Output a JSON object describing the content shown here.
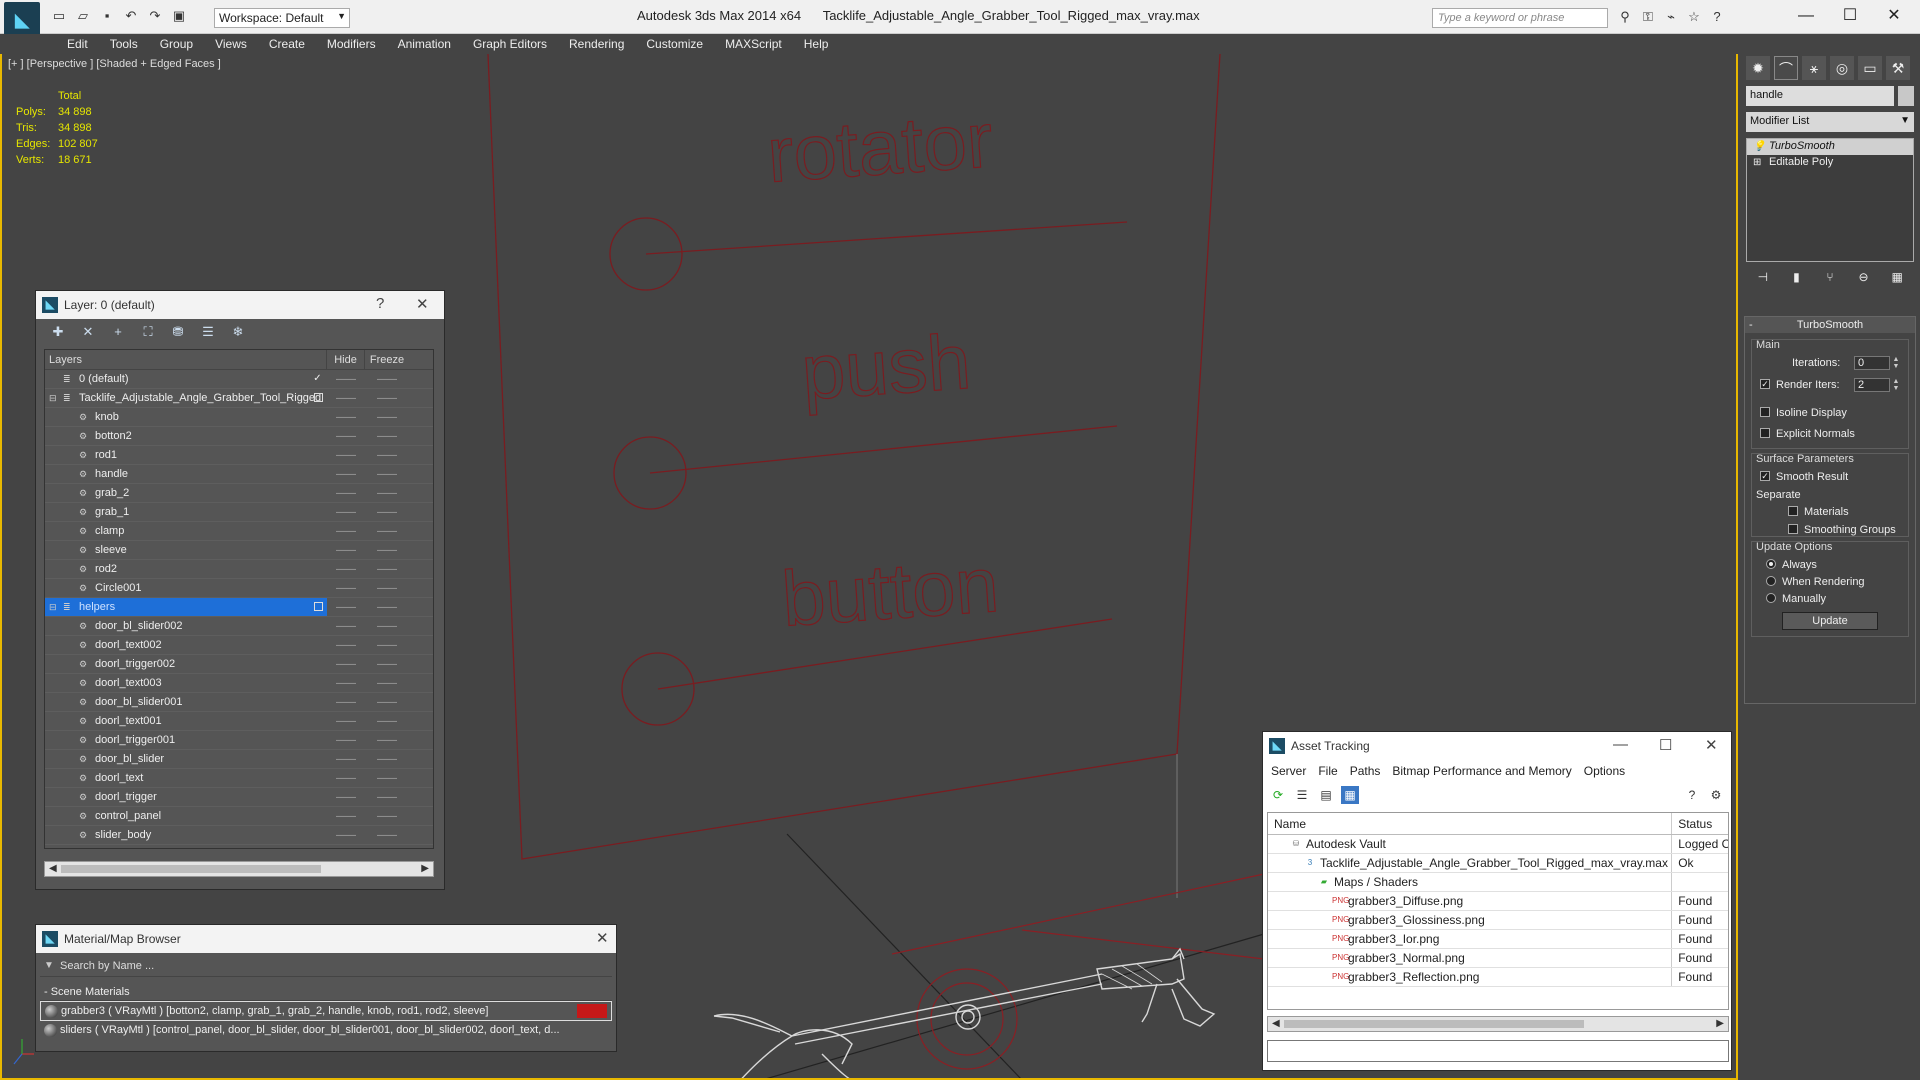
{
  "titlebar": {
    "workspace": "Workspace: Default",
    "app_title": "Autodesk 3ds Max  2014 x64",
    "file_title": "Tacklife_Adjustable_Angle_Grabber_Tool_Rigged_max_vray.max",
    "search_placeholder": "Type a keyword or phrase"
  },
  "menu": [
    "Edit",
    "Tools",
    "Group",
    "Views",
    "Create",
    "Modifiers",
    "Animation",
    "Graph Editors",
    "Rendering",
    "Customize",
    "MAXScript",
    "Help"
  ],
  "viewport": {
    "label": "[+ ] [Perspective ] [Shaded + Edged Faces ]",
    "stats": {
      "total_label": "Total",
      "polys_label": "Polys:",
      "polys": "34 898",
      "tris_label": "Tris:",
      "tris": "34 898",
      "edges_label": "Edges:",
      "edges": "102 807",
      "verts_label": "Verts:",
      "verts": "18 671"
    },
    "panel_labels": [
      "rotator",
      "push",
      "button"
    ]
  },
  "layer_dialog": {
    "title": "Layer: 0 (default)",
    "col_layers": "Layers",
    "col_hide": "Hide",
    "col_freeze": "Freeze",
    "rows": [
      {
        "name": "0 (default)",
        "level": 0,
        "kind": "layer",
        "mark": "check"
      },
      {
        "name": "Tacklife_Adjustable_Angle_Grabber_Tool_Rigged",
        "level": 0,
        "kind": "layer",
        "mark": "box"
      },
      {
        "name": "knob",
        "level": 1,
        "kind": "obj"
      },
      {
        "name": "botton2",
        "level": 1,
        "kind": "obj"
      },
      {
        "name": "rod1",
        "level": 1,
        "kind": "obj"
      },
      {
        "name": "handle",
        "level": 1,
        "kind": "obj"
      },
      {
        "name": "grab_2",
        "level": 1,
        "kind": "obj"
      },
      {
        "name": "grab_1",
        "level": 1,
        "kind": "obj"
      },
      {
        "name": "clamp",
        "level": 1,
        "kind": "obj"
      },
      {
        "name": "sleeve",
        "level": 1,
        "kind": "obj"
      },
      {
        "name": "rod2",
        "level": 1,
        "kind": "obj"
      },
      {
        "name": "Circle001",
        "level": 1,
        "kind": "obj"
      },
      {
        "name": "helpers",
        "level": 0,
        "kind": "layer",
        "mark": "box",
        "selected": true
      },
      {
        "name": "door_bl_slider002",
        "level": 1,
        "kind": "obj"
      },
      {
        "name": "doorl_text002",
        "level": 1,
        "kind": "obj"
      },
      {
        "name": "doorl_trigger002",
        "level": 1,
        "kind": "obj"
      },
      {
        "name": "doorl_text003",
        "level": 1,
        "kind": "obj"
      },
      {
        "name": "door_bl_slider001",
        "level": 1,
        "kind": "obj"
      },
      {
        "name": "doorl_text001",
        "level": 1,
        "kind": "obj"
      },
      {
        "name": "doorl_trigger001",
        "level": 1,
        "kind": "obj"
      },
      {
        "name": "door_bl_slider",
        "level": 1,
        "kind": "obj"
      },
      {
        "name": "doorl_text",
        "level": 1,
        "kind": "obj"
      },
      {
        "name": "doorl_trigger",
        "level": 1,
        "kind": "obj"
      },
      {
        "name": "control_panel",
        "level": 1,
        "kind": "obj"
      },
      {
        "name": "slider_body",
        "level": 1,
        "kind": "obj"
      }
    ]
  },
  "material_browser": {
    "title": "Material/Map Browser",
    "search_placeholder": "Search by Name ...",
    "section": "- Scene Materials",
    "materials": [
      "grabber3  ( VRayMtl )  [botton2, clamp, grab_1, grab_2, handle, knob, rod1, rod2, sleeve]",
      "sliders ( VRayMtl ) [control_panel, door_bl_slider, door_bl_slider001, door_bl_slider002, doorl_text, d..."
    ]
  },
  "asset_tracking": {
    "title": "Asset Tracking",
    "menu": [
      "Server",
      "File",
      "Paths",
      "Bitmap Performance and Memory",
      "Options"
    ],
    "col_name": "Name",
    "col_status": "Status",
    "rows": [
      {
        "name": "Autodesk Vault",
        "status": "Logged O",
        "level": 1,
        "icon": "vault"
      },
      {
        "name": "Tacklife_Adjustable_Angle_Grabber_Tool_Rigged_max_vray.max",
        "status": "Ok",
        "level": 2,
        "icon": "max"
      },
      {
        "name": "Maps / Shaders",
        "status": "",
        "level": 3,
        "icon": "maps"
      },
      {
        "name": "grabber3_Diffuse.png",
        "status": "Found",
        "level": 4,
        "icon": "png"
      },
      {
        "name": "grabber3_Glossiness.png",
        "status": "Found",
        "level": 4,
        "icon": "png"
      },
      {
        "name": "grabber3_Ior.png",
        "status": "Found",
        "level": 4,
        "icon": "png"
      },
      {
        "name": "grabber3_Normal.png",
        "status": "Found",
        "level": 4,
        "icon": "png"
      },
      {
        "name": "grabber3_Reflection.png",
        "status": "Found",
        "level": 4,
        "icon": "png"
      }
    ]
  },
  "command_panel": {
    "object_name": "handle",
    "modifier_list": "Modifier List",
    "stack": [
      "TurboSmooth",
      "Editable Poly"
    ],
    "rollout_title": "TurboSmooth",
    "main_label": "Main",
    "iterations_label": "Iterations:",
    "iterations": "0",
    "render_iters_label": "Render Iters:",
    "render_iters": "2",
    "render_iters_checked": true,
    "isoline_label": "Isoline Display",
    "explicit_normals_label": "Explicit Normals",
    "surface_params_label": "Surface Parameters",
    "smooth_result_label": "Smooth Result",
    "separate_label": "Separate",
    "materials_label": "Materials",
    "smoothing_groups_label": "Smoothing Groups",
    "update_options_label": "Update Options",
    "always_label": "Always",
    "when_rendering_label": "When Rendering",
    "manually_label": "Manually",
    "update_button": "Update"
  },
  "colors": {
    "viewport_bg": "#444444",
    "selection_blue": "#1e6fd8",
    "wire_red": "#8a1f24",
    "active_border": "#e8b800",
    "stats_yellow": "#e6e600"
  }
}
